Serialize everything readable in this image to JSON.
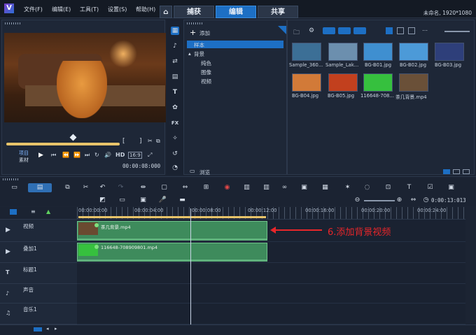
{
  "app": {
    "logo": "V",
    "project_info": "未命名, 1920*1080"
  },
  "menu": [
    "文件(F)",
    "编辑(E)",
    "工具(T)",
    "设置(S)",
    "帮助(H)"
  ],
  "tabs": [
    {
      "icon": "home-icon"
    },
    {
      "label": "捕获"
    },
    {
      "label": "编辑",
      "active": true
    },
    {
      "label": "共享"
    }
  ],
  "player": {
    "project_label": "项目",
    "clip_label": "素材",
    "hd_label": "HD",
    "timecode": "00:00:08:000"
  },
  "library": {
    "add_label": "添加",
    "tree": [
      "样本",
      "背景",
      "纯色",
      "图像",
      "视频"
    ],
    "browse_label": "浏览",
    "items": [
      {
        "label": "Sample_360...",
        "thumb": "#3c6f96"
      },
      {
        "label": "Sample_Lak...",
        "thumb": "#6c8fae"
      },
      {
        "label": "BG-B01.jpg",
        "thumb": "#3f8fd0"
      },
      {
        "label": "BG-B02.jpg",
        "thumb": "#4c9ad8"
      },
      {
        "label": "BG-B03.jpg",
        "thumb": "#2e3f7a"
      },
      {
        "label": "BG-B04.jpg",
        "thumb": "#d27a38"
      },
      {
        "label": "BG-B05.jpg",
        "thumb": "#c2401e"
      },
      {
        "label": "116648-708...",
        "thumb": "#36c03e"
      },
      {
        "label": "茶几背景.mp4",
        "thumb": "#6a5038"
      }
    ]
  },
  "timeline": {
    "timecode": "0:00:13:013",
    "ruler": [
      "00:00:00:00",
      "00:00:04:00",
      "00:00:08:00",
      "00:00:12:00",
      "00:00:16:00",
      "00:00:20:00",
      "00:00:24:00"
    ],
    "tracks": [
      {
        "name": "视频",
        "icon": "video-track-icon"
      },
      {
        "name": "叠加1",
        "icon": "overlay-track-icon"
      },
      {
        "name": "标题1",
        "icon": "title-track-icon"
      },
      {
        "name": "声音",
        "icon": "voice-track-icon"
      },
      {
        "name": "音乐1",
        "icon": "music-track-icon"
      }
    ],
    "clips": [
      {
        "label": "茶几背景.mp4"
      },
      {
        "label": "116648-708909801.mp4"
      }
    ]
  },
  "annotation": "6.添加背景视频",
  "colors": {
    "accent": "#1d6fc4",
    "clip": "#3e8b5c",
    "annotation": "#e8262a"
  }
}
